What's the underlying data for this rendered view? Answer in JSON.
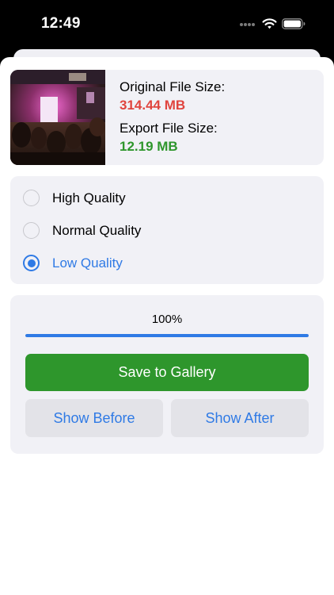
{
  "status_bar": {
    "time": "12:49",
    "icons": [
      "cellular-dots-icon",
      "wifi-icon",
      "battery-icon"
    ]
  },
  "colors": {
    "original_size": "#e0443e",
    "export_size": "#2e962c",
    "accent": "#2f7ae5",
    "save_button": "#2e962c",
    "card_background": "#f1f1f6"
  },
  "file_info": {
    "thumbnail": "concert-video-thumbnail",
    "original_label": "Original File Size:",
    "original_value": "314.44 MB",
    "export_label": "Export File Size:",
    "export_value": "12.19 MB"
  },
  "quality": {
    "options": [
      {
        "label": "High Quality",
        "selected": false
      },
      {
        "label": "Normal Quality",
        "selected": false
      },
      {
        "label": "Low Quality",
        "selected": true
      }
    ]
  },
  "export": {
    "progress_text": "100%",
    "progress_fraction": 1.0,
    "save_label": "Save to Gallery",
    "show_before_label": "Show Before",
    "show_after_label": "Show After"
  }
}
